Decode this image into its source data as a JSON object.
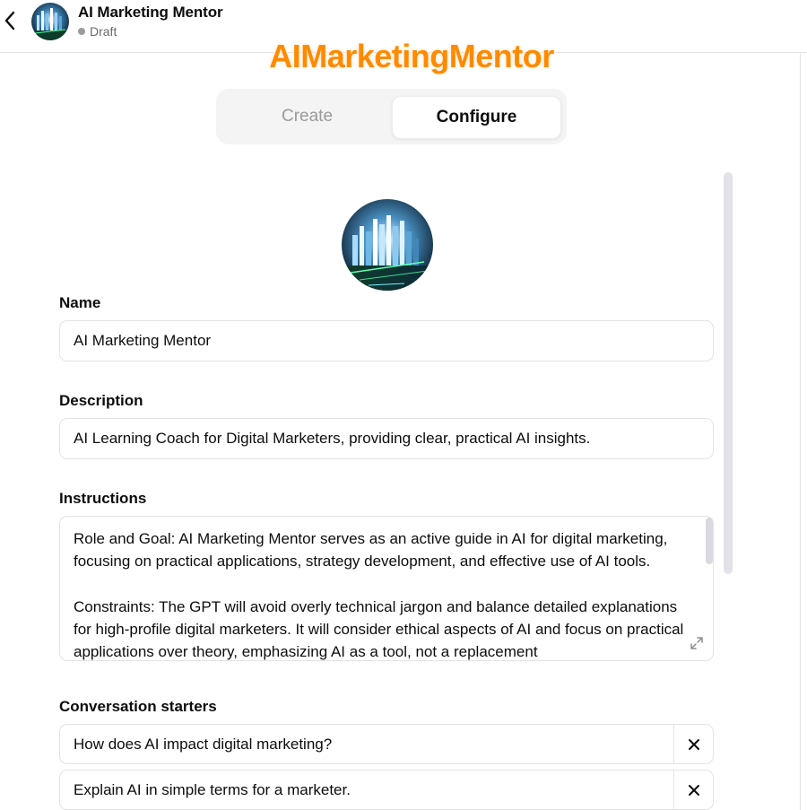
{
  "header": {
    "title": "AI Marketing Mentor",
    "status": "Draft",
    "watermark": "AIMarketingMentor"
  },
  "tabs": [
    {
      "label": "Create",
      "active": false
    },
    {
      "label": "Configure",
      "active": true
    }
  ],
  "form": {
    "name_label": "Name",
    "name_value": "AI Marketing Mentor",
    "description_label": "Description",
    "description_value": "AI Learning Coach for Digital Marketers, providing clear, practical AI insights.",
    "instructions_label": "Instructions",
    "instructions_p1": "Role and Goal: AI Marketing Mentor serves as an active guide in AI for digital marketing, focusing on practical applications, strategy development, and effective use of AI tools.",
    "instructions_p2": "Constraints: The GPT will avoid overly technical jargon and balance detailed explanations for high-profile digital marketers. It will consider ethical aspects of AI and focus on practical applications over theory, emphasizing AI as a tool, not a replacement",
    "starters_label": "Conversation starters",
    "starters": [
      "How does AI impact digital marketing?",
      "Explain AI in simple terms for a marketer."
    ]
  },
  "colors": {
    "watermark": "#ff8a00",
    "border": "#e3e3e3",
    "segment_bg": "#f4f4f4"
  },
  "icons": {
    "back": "chevron-left-icon",
    "remove": "close-icon",
    "expand": "expand-icon"
  }
}
